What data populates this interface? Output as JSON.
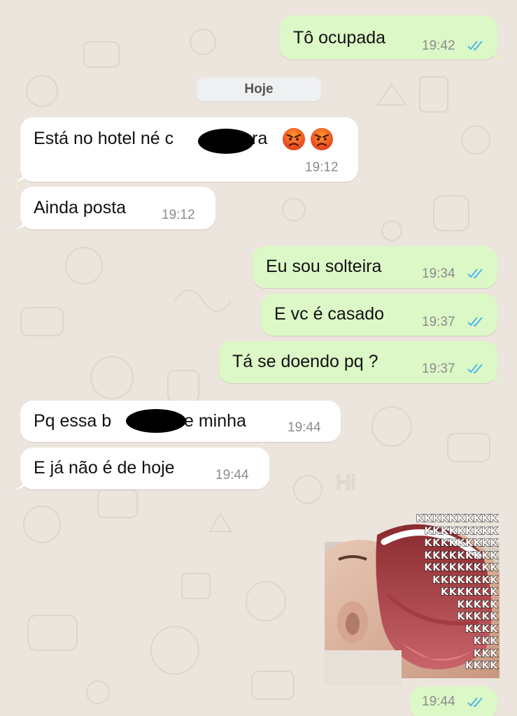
{
  "date_divider": "Hoje",
  "messages": [
    {
      "id": "m1",
      "dir": "out",
      "text": "Tô ocupada",
      "time": "19:42",
      "read": true
    },
    {
      "id": "m2",
      "dir": "in",
      "text_before": "Está no hotel né c",
      "text_after": "ra",
      "emojis": [
        "angry-face",
        "angry-face"
      ],
      "time": "19:12"
    },
    {
      "id": "m3",
      "dir": "in",
      "text": "Ainda posta",
      "time": "19:12"
    },
    {
      "id": "m4",
      "dir": "out",
      "text": "Eu sou solteira",
      "time": "19:34",
      "read": true
    },
    {
      "id": "m5",
      "dir": "out",
      "text": "E vc é casado",
      "time": "19:37",
      "read": true
    },
    {
      "id": "m6",
      "dir": "out",
      "text": "Tá se doendo pq ?",
      "time": "19:37",
      "read": true
    },
    {
      "id": "m7",
      "dir": "in",
      "text_before": "Pq essa b",
      "text_after": "e minha",
      "time": "19:44"
    },
    {
      "id": "m8",
      "dir": "in",
      "text": "E já não é de hoje",
      "time": "19:44"
    },
    {
      "id": "m9",
      "dir": "out",
      "type": "sticker",
      "time": "19:44",
      "read": true
    }
  ],
  "sticker": {
    "lines": [
      "KKKKKKKKKK",
      "KKKKKKKKK",
      "KKKKKKKKK",
      "KKKKKKKKK",
      "KKKKKKKKK",
      "KKKKKKKK",
      "KKKKKKK",
      "KKKKK",
      "KKKKK",
      "KKKK",
      "KKK",
      "KKK",
      "KKKK"
    ]
  },
  "colors": {
    "outgoing_bubble": "#dcf8c6",
    "incoming_bubble": "#ffffff",
    "background": "#ece5dd",
    "read_ticks": "#4fb6ec"
  }
}
